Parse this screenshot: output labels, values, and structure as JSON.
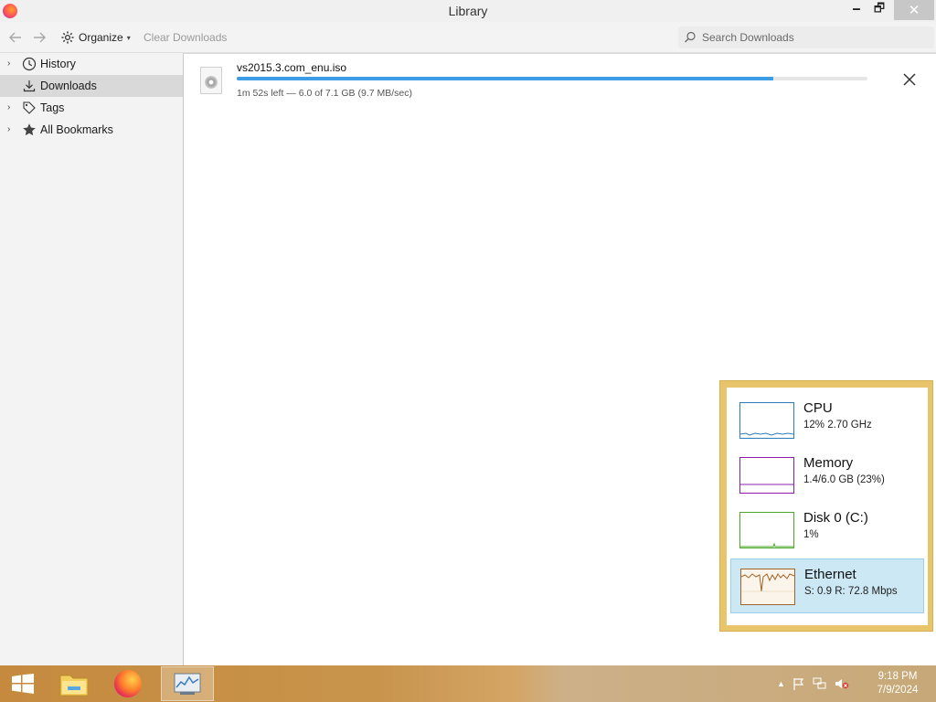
{
  "window": {
    "title": "Library",
    "minimize": "🗕",
    "restore": "🗗",
    "close": "✕"
  },
  "toolbar": {
    "organize_label": "Organize",
    "clear_label": "Clear Downloads",
    "search_placeholder": "Search Downloads"
  },
  "sidebar": {
    "items": [
      {
        "label": "History",
        "icon": "clock-icon",
        "expandable": true,
        "selected": false
      },
      {
        "label": "Downloads",
        "icon": "download-icon",
        "expandable": false,
        "selected": true
      },
      {
        "label": "Tags",
        "icon": "tag-icon",
        "expandable": true,
        "selected": false
      },
      {
        "label": "All Bookmarks",
        "icon": "star-icon",
        "expandable": true,
        "selected": false
      }
    ]
  },
  "downloads": [
    {
      "filename": "vs2015.3.com_enu.iso",
      "status": "1m 52s left — 6.0 of 7.1 GB (9.7 MB/sec)",
      "progress_fraction": 0.85
    }
  ],
  "perf": {
    "items": [
      {
        "name": "CPU",
        "value": "12% 2.70 GHz",
        "color": "#2b7bbd",
        "selected": false
      },
      {
        "name": "Memory",
        "value": "1.4/6.0 GB (23%)",
        "color": "#8b1fa8",
        "selected": false
      },
      {
        "name": "Disk 0 (C:)",
        "value": "1%",
        "color": "#4ca82b",
        "selected": false
      },
      {
        "name": "Ethernet",
        "value": "S: 0.9 R: 72.8 Mbps",
        "color": "#a0642a",
        "selected": true
      }
    ]
  },
  "taskbar": {
    "clock_time": "9:18 PM",
    "clock_date": "7/9/2024"
  },
  "colors": {
    "progress": "#3d9ce6",
    "selection": "#d9d9d9",
    "accent_frame": "#e8c56a"
  }
}
